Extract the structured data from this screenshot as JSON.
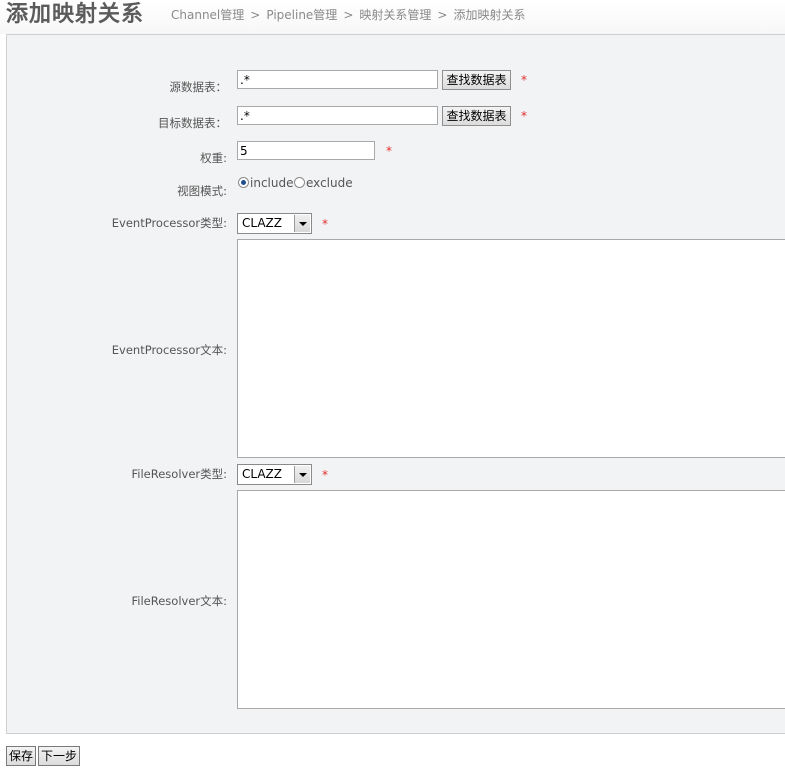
{
  "header": {
    "title": "添加映射关系",
    "breadcrumb": [
      {
        "label": "Channel管理"
      },
      {
        "label": "Pipeline管理"
      },
      {
        "label": "映射关系管理"
      },
      {
        "label": "添加映射关系"
      }
    ],
    "separator": ">"
  },
  "form": {
    "source_table": {
      "label": "源数据表：",
      "value": ".*",
      "button_label": "查找数据表",
      "required_mark": "*"
    },
    "target_table": {
      "label": "目标数据表：",
      "value": ".*",
      "button_label": "查找数据表",
      "required_mark": "*"
    },
    "weight": {
      "label": "权重:",
      "value": "5",
      "required_mark": "*"
    },
    "view_mode": {
      "label": "视图模式:",
      "options": [
        {
          "label": "include",
          "checked": true
        },
        {
          "label": "exclude",
          "checked": false
        }
      ]
    },
    "event_processor_type": {
      "label": "EventProcessor类型:",
      "selected": "CLAZZ",
      "required_mark": "*"
    },
    "event_processor_text": {
      "label": "EventProcessor文本:",
      "value": ""
    },
    "file_resolver_type": {
      "label": "FileResolver类型:",
      "selected": "CLAZZ",
      "required_mark": "*"
    },
    "file_resolver_text": {
      "label": "FileResolver文本:",
      "value": ""
    }
  },
  "actions": {
    "save_label": "保存",
    "next_label": "下一步"
  },
  "colors": {
    "panel_bg": "#f2f3f4",
    "required": "#e03030",
    "title": "#5b5b5b"
  }
}
